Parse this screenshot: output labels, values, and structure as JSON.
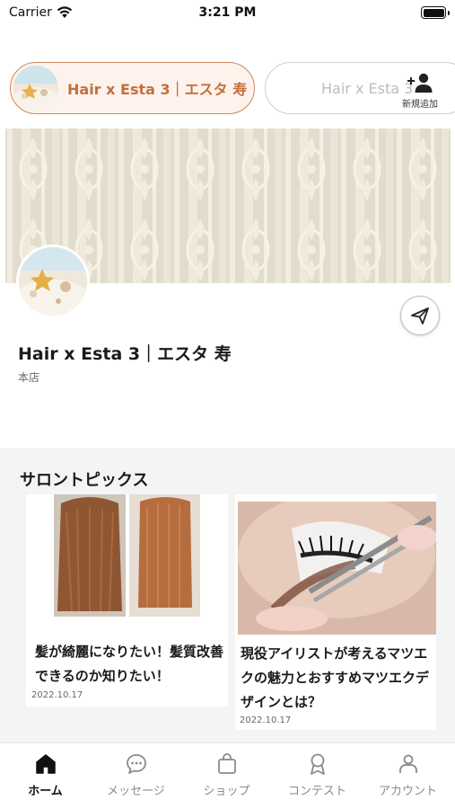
{
  "status_bar": {
    "carrier": "Carrier",
    "time": "3:21 PM"
  },
  "salon_chips": [
    {
      "label": "Hair x Esta 3｜エスタ 寿",
      "active": true
    },
    {
      "label": "Hair x Esta 3",
      "active": false
    }
  ],
  "add_button": {
    "label": "新規追加",
    "icon": "person-add-icon"
  },
  "profile": {
    "name": "Hair x Esta 3｜エスタ 寿",
    "branch": "本店",
    "share_icon": "paper-plane-icon"
  },
  "topics": {
    "title": "サロントピックス",
    "cards": [
      {
        "title": "髪が綺麗になりたい！髪質改善できるのか知りたい！",
        "date": "2022.10.17"
      },
      {
        "title": "現役アイリストが考えるマツエクの魅力とおすすめマツエクデザインとは？",
        "date": "2022.10.17"
      }
    ]
  },
  "tabbar": {
    "tabs": [
      {
        "label": "ホーム",
        "icon": "home-icon",
        "active": true
      },
      {
        "label": "メッセージ",
        "icon": "chat-bubble-icon",
        "active": false
      },
      {
        "label": "ショップ",
        "icon": "shopping-bag-icon",
        "active": false
      },
      {
        "label": "コンテスト",
        "icon": "award-ribbon-icon",
        "active": false
      },
      {
        "label": "アカウント",
        "icon": "account-person-icon",
        "active": false
      }
    ]
  },
  "colors": {
    "accent": "#c46e3e",
    "chip_border": "#c98860",
    "chip_bg": "#fdf3ec",
    "topics_bg": "#f4f4f4"
  }
}
